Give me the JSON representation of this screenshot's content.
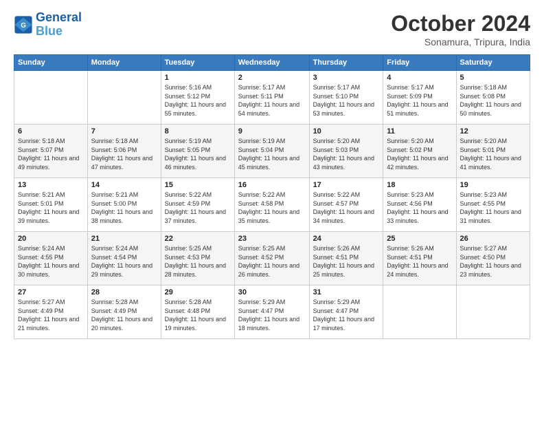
{
  "logo": {
    "line1": "General",
    "line2": "Blue"
  },
  "title": "October 2024",
  "subtitle": "Sonamura, Tripura, India",
  "weekdays": [
    "Sunday",
    "Monday",
    "Tuesday",
    "Wednesday",
    "Thursday",
    "Friday",
    "Saturday"
  ],
  "weeks": [
    [
      {
        "day": "",
        "info": ""
      },
      {
        "day": "",
        "info": ""
      },
      {
        "day": "1",
        "info": "Sunrise: 5:16 AM\nSunset: 5:12 PM\nDaylight: 11 hours and 55 minutes."
      },
      {
        "day": "2",
        "info": "Sunrise: 5:17 AM\nSunset: 5:11 PM\nDaylight: 11 hours and 54 minutes."
      },
      {
        "day": "3",
        "info": "Sunrise: 5:17 AM\nSunset: 5:10 PM\nDaylight: 11 hours and 53 minutes."
      },
      {
        "day": "4",
        "info": "Sunrise: 5:17 AM\nSunset: 5:09 PM\nDaylight: 11 hours and 51 minutes."
      },
      {
        "day": "5",
        "info": "Sunrise: 5:18 AM\nSunset: 5:08 PM\nDaylight: 11 hours and 50 minutes."
      }
    ],
    [
      {
        "day": "6",
        "info": "Sunrise: 5:18 AM\nSunset: 5:07 PM\nDaylight: 11 hours and 49 minutes."
      },
      {
        "day": "7",
        "info": "Sunrise: 5:18 AM\nSunset: 5:06 PM\nDaylight: 11 hours and 47 minutes."
      },
      {
        "day": "8",
        "info": "Sunrise: 5:19 AM\nSunset: 5:05 PM\nDaylight: 11 hours and 46 minutes."
      },
      {
        "day": "9",
        "info": "Sunrise: 5:19 AM\nSunset: 5:04 PM\nDaylight: 11 hours and 45 minutes."
      },
      {
        "day": "10",
        "info": "Sunrise: 5:20 AM\nSunset: 5:03 PM\nDaylight: 11 hours and 43 minutes."
      },
      {
        "day": "11",
        "info": "Sunrise: 5:20 AM\nSunset: 5:02 PM\nDaylight: 11 hours and 42 minutes."
      },
      {
        "day": "12",
        "info": "Sunrise: 5:20 AM\nSunset: 5:01 PM\nDaylight: 11 hours and 41 minutes."
      }
    ],
    [
      {
        "day": "13",
        "info": "Sunrise: 5:21 AM\nSunset: 5:01 PM\nDaylight: 11 hours and 39 minutes."
      },
      {
        "day": "14",
        "info": "Sunrise: 5:21 AM\nSunset: 5:00 PM\nDaylight: 11 hours and 38 minutes."
      },
      {
        "day": "15",
        "info": "Sunrise: 5:22 AM\nSunset: 4:59 PM\nDaylight: 11 hours and 37 minutes."
      },
      {
        "day": "16",
        "info": "Sunrise: 5:22 AM\nSunset: 4:58 PM\nDaylight: 11 hours and 35 minutes."
      },
      {
        "day": "17",
        "info": "Sunrise: 5:22 AM\nSunset: 4:57 PM\nDaylight: 11 hours and 34 minutes."
      },
      {
        "day": "18",
        "info": "Sunrise: 5:23 AM\nSunset: 4:56 PM\nDaylight: 11 hours and 33 minutes."
      },
      {
        "day": "19",
        "info": "Sunrise: 5:23 AM\nSunset: 4:55 PM\nDaylight: 11 hours and 31 minutes."
      }
    ],
    [
      {
        "day": "20",
        "info": "Sunrise: 5:24 AM\nSunset: 4:55 PM\nDaylight: 11 hours and 30 minutes."
      },
      {
        "day": "21",
        "info": "Sunrise: 5:24 AM\nSunset: 4:54 PM\nDaylight: 11 hours and 29 minutes."
      },
      {
        "day": "22",
        "info": "Sunrise: 5:25 AM\nSunset: 4:53 PM\nDaylight: 11 hours and 28 minutes."
      },
      {
        "day": "23",
        "info": "Sunrise: 5:25 AM\nSunset: 4:52 PM\nDaylight: 11 hours and 26 minutes."
      },
      {
        "day": "24",
        "info": "Sunrise: 5:26 AM\nSunset: 4:51 PM\nDaylight: 11 hours and 25 minutes."
      },
      {
        "day": "25",
        "info": "Sunrise: 5:26 AM\nSunset: 4:51 PM\nDaylight: 11 hours and 24 minutes."
      },
      {
        "day": "26",
        "info": "Sunrise: 5:27 AM\nSunset: 4:50 PM\nDaylight: 11 hours and 23 minutes."
      }
    ],
    [
      {
        "day": "27",
        "info": "Sunrise: 5:27 AM\nSunset: 4:49 PM\nDaylight: 11 hours and 21 minutes."
      },
      {
        "day": "28",
        "info": "Sunrise: 5:28 AM\nSunset: 4:49 PM\nDaylight: 11 hours and 20 minutes."
      },
      {
        "day": "29",
        "info": "Sunrise: 5:28 AM\nSunset: 4:48 PM\nDaylight: 11 hours and 19 minutes."
      },
      {
        "day": "30",
        "info": "Sunrise: 5:29 AM\nSunset: 4:47 PM\nDaylight: 11 hours and 18 minutes."
      },
      {
        "day": "31",
        "info": "Sunrise: 5:29 AM\nSunset: 4:47 PM\nDaylight: 11 hours and 17 minutes."
      },
      {
        "day": "",
        "info": ""
      },
      {
        "day": "",
        "info": ""
      }
    ]
  ]
}
